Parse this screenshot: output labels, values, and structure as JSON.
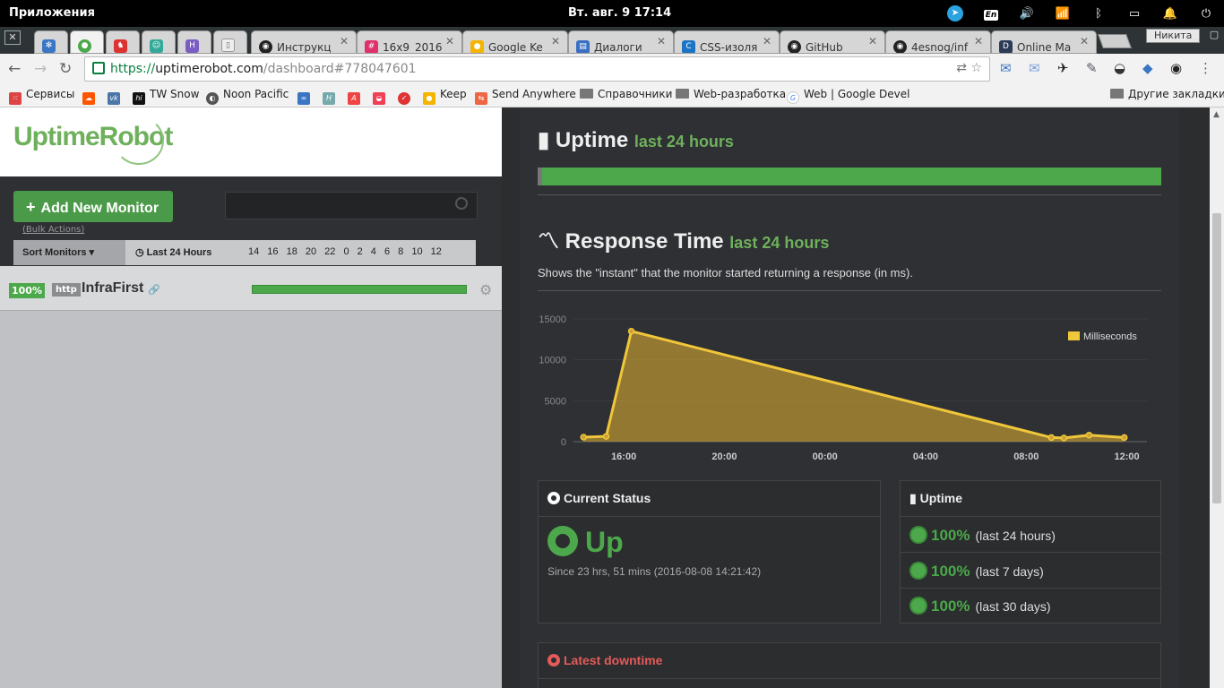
{
  "topbar": {
    "apps_label": "Приложения",
    "clock": "Вт. авг.  9    17:14",
    "lang": "En"
  },
  "tabs": [
    {
      "title": "Инструкц",
      "icon": "github-icon"
    },
    {
      "title": "16x9_2016",
      "icon": "slack-icon"
    },
    {
      "title": "Google Ke",
      "icon": "keep-icon"
    },
    {
      "title": "Диалоги",
      "icon": "chat-icon"
    },
    {
      "title": "CSS-изоля",
      "icon": "css-live-icon"
    },
    {
      "title": "GitHub",
      "icon": "github-icon"
    },
    {
      "title": "4esnog/inf",
      "icon": "github-icon"
    },
    {
      "title": "Online Ma",
      "icon": "d-icon"
    }
  ],
  "profile_name": "Никита",
  "url": {
    "protocol": "https://",
    "host": "uptimerobot.com",
    "path": "/dashboard#778047601"
  },
  "bookmarks": [
    {
      "label": "Сервисы",
      "type": "apps"
    },
    {
      "label": "",
      "type": "soundcloud"
    },
    {
      "label": "",
      "type": "vk"
    },
    {
      "label": "TW Snow",
      "type": "hi"
    },
    {
      "label": "Noon Pacific",
      "type": "site"
    },
    {
      "label": "",
      "type": "infinity"
    },
    {
      "label": "",
      "type": "h"
    },
    {
      "label": "",
      "type": "a"
    },
    {
      "label": "",
      "type": "pocket"
    },
    {
      "label": "",
      "type": "todo"
    },
    {
      "label": "Keep",
      "type": "keep"
    },
    {
      "label": "Send Anywhere",
      "type": "send"
    },
    {
      "label": "Справочники",
      "type": "folder"
    },
    {
      "label": "Web-разработка",
      "type": "folder"
    },
    {
      "label": "Web  |  Google Devel",
      "type": "google"
    },
    {
      "label": "Другие закладки",
      "type": "folder"
    }
  ],
  "left": {
    "logo_text": "UptimeRobot",
    "add_button": "Add New Monitor",
    "bulk_actions": "(Bulk Actions)",
    "sort_monitors": "Sort Monitors",
    "last_24": "Last 24 Hours",
    "hours": "14 16 18 20 22 0 2 4 6 8 10 12",
    "monitor": {
      "percent": "100%",
      "type": "http",
      "name": "InfraFirst"
    }
  },
  "right": {
    "uptime_title": "Uptime",
    "uptime_sub": "last 24 hours",
    "uptime_level": 1.0,
    "rt_title": "Response Time",
    "rt_sub": "last 24 hours",
    "rt_desc": "Shows the \"instant\" that the monitor started returning a response (in ms).",
    "status_title": "Current Status",
    "status_value": "Up",
    "status_since": "Since 23 hrs, 51 mins (2016-08-08 14:21:42)",
    "uptime_card_title": "Uptime",
    "uptime_rows": [
      {
        "value": "100%",
        "period": "(last 24 hours)"
      },
      {
        "value": "100%",
        "period": "(last 7 days)"
      },
      {
        "value": "100%",
        "period": "(last 30 days)"
      }
    ],
    "downtime_title": "Latest downtime"
  },
  "chart_data": {
    "type": "area",
    "title": "",
    "xlabel": "",
    "ylabel": "",
    "legend": "top-right",
    "series": [
      {
        "name": "Milliseconds",
        "color": "#f0c63a",
        "points": [
          [
            14.4,
            550
          ],
          [
            15.3,
            650
          ],
          [
            16.3,
            13500
          ],
          [
            9.0,
            500
          ],
          [
            9.5,
            450
          ],
          [
            10.5,
            800
          ],
          [
            11.9,
            500
          ]
        ]
      }
    ],
    "x_ticks": [
      "16:00",
      "20:00",
      "00:00",
      "04:00",
      "08:00",
      "12:00"
    ],
    "y_ticks": [
      "0",
      "5000",
      "10000",
      "15000"
    ],
    "ylim": [
      0,
      15000
    ]
  },
  "colors": {
    "accent": "#4ca84a",
    "chart": "#f0c63a",
    "alert": "#e35b5b"
  }
}
